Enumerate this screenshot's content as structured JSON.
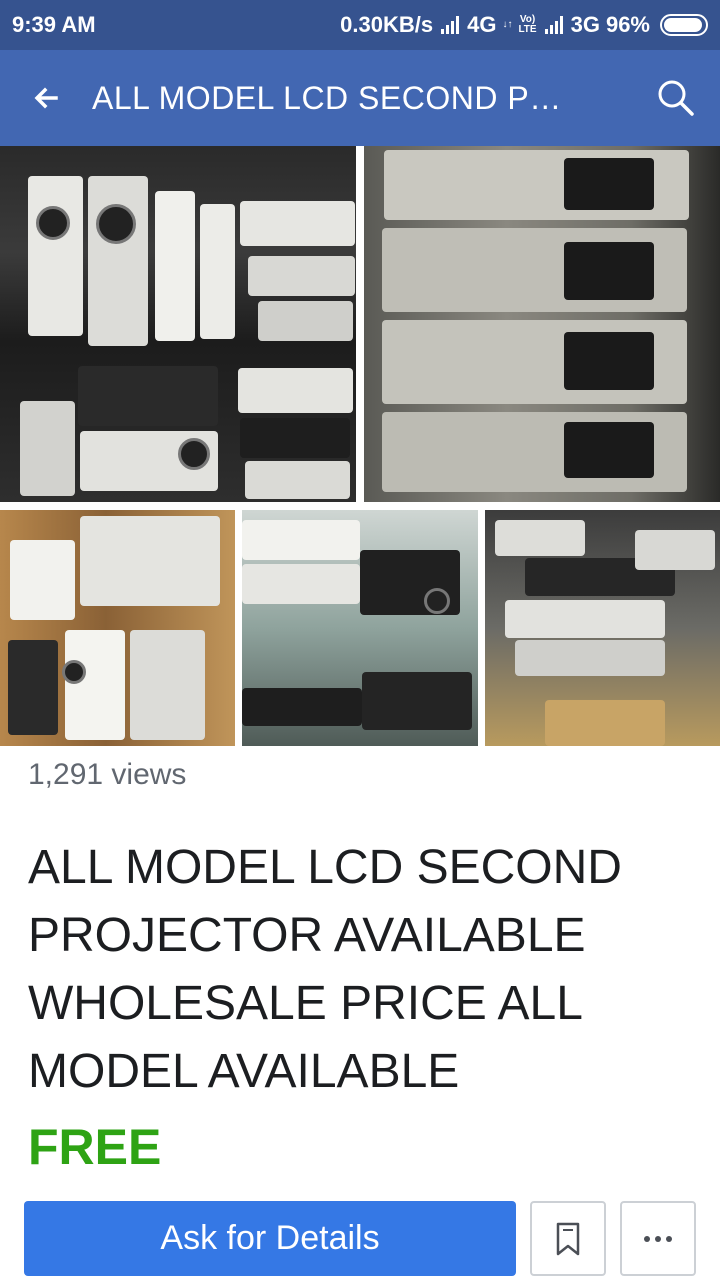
{
  "status_bar": {
    "time": "9:39 AM",
    "network_speed": "0.30KB/s",
    "network1": "4G",
    "volte_top": "Vo)",
    "volte_bottom": "LTE",
    "network2": "3G",
    "battery": "96%",
    "battery_level": 0.96
  },
  "app_bar": {
    "back_icon": "arrow-left-icon",
    "title": "ALL MODEL LCD SECOND PR...",
    "search_icon": "search-icon"
  },
  "photos": [
    {
      "subject": "projectors stacked on shelves"
    },
    {
      "subject": "stacked projectors close-up"
    },
    {
      "subject": "projectors on wooden shelves"
    },
    {
      "subject": "projectors on glass shelves"
    },
    {
      "subject": "pile of projectors"
    }
  ],
  "listing": {
    "views": "1,291 views",
    "title": "ALL MODEL LCD SECOND PROJECTOR AVAILABLE WHOLESALE PRICE ALL MODEL AVAILABLE",
    "price": "FREE"
  },
  "actions": {
    "ask_label": "Ask for Details",
    "save_icon": "bookmark-icon",
    "more_icon": "more-horizontal-icon"
  },
  "colors": {
    "status_bar": "#36538f",
    "app_bar": "#4267b2",
    "primary_button": "#3578e5",
    "price": "#2ea314"
  }
}
